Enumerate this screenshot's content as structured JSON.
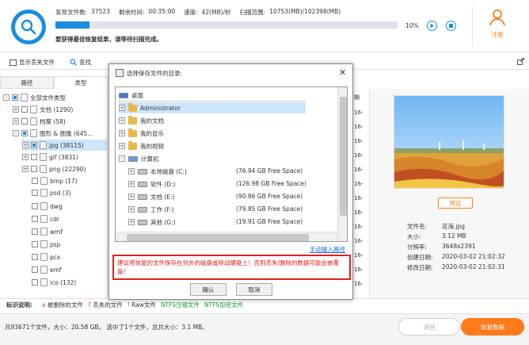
{
  "header": {
    "found_label": "发现文件数:",
    "found_value": "37523",
    "remain_label": "剩余时间:",
    "remain_value": "00:35:00",
    "speed_label": "速度:",
    "speed_value": "42(MB)/秒",
    "scanned_label": "扫描范围:",
    "scanned_value": "10753(MB)/102398(MB)",
    "progress_percent": 10,
    "progress_label": "10%",
    "message": "要获得最佳恢复结果，请等待扫描完成。",
    "register_label": "注册",
    "colors": {
      "accent": "#1a8de0",
      "orange": "#ff7a1a"
    }
  },
  "toolbar": {
    "show_lost": "显示丢失文件",
    "search": "查找"
  },
  "tabs": [
    {
      "label": "路径"
    },
    {
      "label": "类型"
    }
  ],
  "tree": [
    {
      "label": "全部文件类型"
    },
    {
      "label": "文档 (1290)"
    },
    {
      "label": "档案 (58)"
    },
    {
      "label": "图形 & 图像 (645..."
    },
    {
      "label": "jpg (38115)"
    },
    {
      "label": "gif (3831)"
    },
    {
      "label": "png (22290)"
    },
    {
      "label": "bmp (17)"
    },
    {
      "label": "psd (3)"
    },
    {
      "label": "dwg"
    },
    {
      "label": "cdr"
    },
    {
      "label": "wmf"
    },
    {
      "label": "psp"
    },
    {
      "label": "pcx"
    },
    {
      "label": "emf"
    },
    {
      "label": "ico (132)"
    }
  ],
  "midcol": {
    "header": "期",
    "cells": [
      "16-",
      "16-",
      "16-",
      "16-",
      "16-",
      "16-",
      "16-",
      "16-",
      "16-",
      "16-",
      "16-",
      "16-",
      "16-"
    ]
  },
  "preview": {
    "button": "预览",
    "file_info": [
      {
        "key": "文件名:",
        "value": "花海.jpg"
      },
      {
        "key": "大小:",
        "value": "3.12 MB"
      },
      {
        "key": "分辨率:",
        "value": "3648x2391"
      },
      {
        "key": "创建日期:",
        "value": "2020-03-02 21:02:32"
      },
      {
        "key": "修改日期:",
        "value": "2020-03-02 21:02:31"
      }
    ]
  },
  "legend": {
    "label": "标识说明:",
    "items": [
      {
        "icon": "x",
        "text": "被删除的文件",
        "color": "#e02020"
      },
      {
        "icon": "?",
        "text": "丢失的文件",
        "color": "#e02020"
      },
      {
        "icon": "!",
        "text": "Raw文件",
        "color": "#e02020"
      },
      {
        "text": "NTFS压缩文件",
        "color": "#1a9a3a"
      },
      {
        "text": "NTFS加密文件",
        "color": "#1a9a3a"
      }
    ]
  },
  "footer": {
    "summary": "共93671个文件，大小：20.58 GB。 选中了1个文件，总共大小：3.1 MB。",
    "back": "返回",
    "recover": "恢复数据"
  },
  "dialog": {
    "title": "选择保存文件的目录:",
    "items": [
      {
        "label": "桌面"
      },
      {
        "label": "Administrator"
      },
      {
        "label": "我的文档"
      },
      {
        "label": "我的音乐"
      },
      {
        "label": "我的视频"
      },
      {
        "label": "计算机"
      },
      {
        "label": "本地磁盘 (C:)",
        "size": "(76.94 GB Free Space)"
      },
      {
        "label": "软件 (D:)",
        "size": "(126.98 GB Free Space)"
      },
      {
        "label": "文档 (E:)",
        "size": "(90.86 GB Free Space)"
      },
      {
        "label": "工作 (F:)",
        "size": "(79.85 GB Free Space)"
      },
      {
        "label": "其他 (G:)",
        "size": "(19.91 GB Free Space)"
      }
    ],
    "manual": "手动输入路径",
    "warning": "建议将恢复的文件保存在另外的磁盘或移动硬盘上！否则丢失/删除的数据可能会被覆盖！",
    "ok": "确认",
    "cancel": "取消"
  }
}
